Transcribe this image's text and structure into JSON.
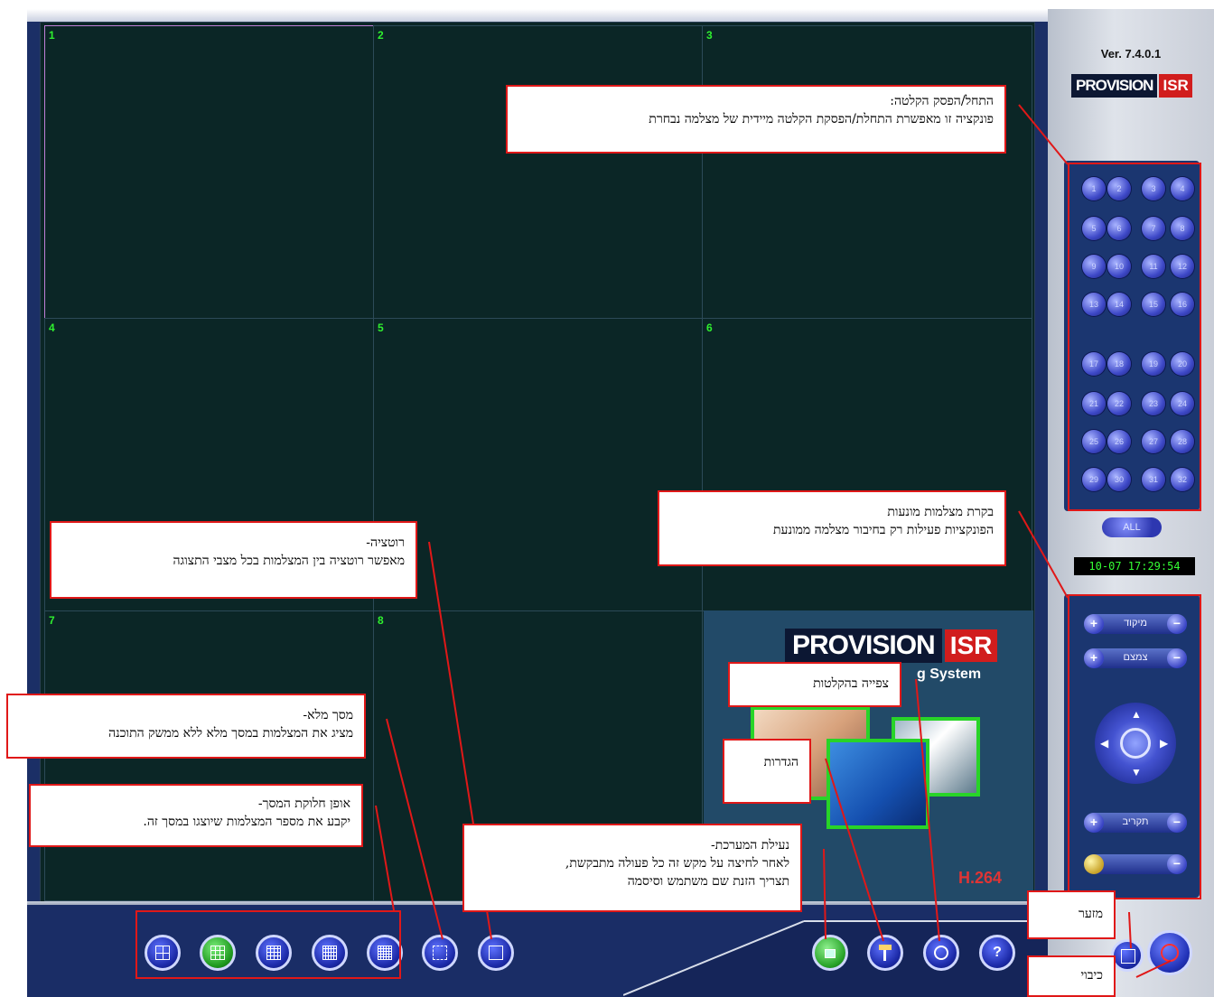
{
  "app": {
    "version": "Ver. 7.4.0.1",
    "brand_main": "PROVISION",
    "brand_suffix": "ISR",
    "splash_partial_text": "g System",
    "codec_label": "H.264",
    "datetime": "10-07 17:29:54",
    "all_button": "ALL"
  },
  "grid": {
    "cells": [
      {
        "num": "1",
        "selected": true
      },
      {
        "num": "2",
        "selected": false
      },
      {
        "num": "3",
        "selected": false
      },
      {
        "num": "4",
        "selected": false
      },
      {
        "num": "5",
        "selected": false
      },
      {
        "num": "6",
        "selected": false
      },
      {
        "num": "7",
        "selected": false
      },
      {
        "num": "8",
        "selected": false
      }
    ]
  },
  "cameras": [
    "1",
    "2",
    "3",
    "4",
    "5",
    "6",
    "7",
    "8",
    "9",
    "10",
    "11",
    "12",
    "13",
    "14",
    "15",
    "16",
    "17",
    "18",
    "19",
    "20",
    "21",
    "22",
    "23",
    "24",
    "25",
    "26",
    "27",
    "28",
    "29",
    "30",
    "31",
    "32"
  ],
  "ptz": {
    "focus_label": "מיקוד",
    "zoom_label": "צמצם",
    "preset_label": "תקריב",
    "plus": "+",
    "minus": "−"
  },
  "layout_buttons": [
    "split-1x1",
    "split-2x2",
    "split-3x3",
    "split-4x4",
    "split-5x5",
    "fullscreen",
    "rotation"
  ],
  "action_buttons": [
    "lock",
    "settings",
    "playback",
    "help",
    "minimize",
    "power"
  ],
  "callouts": {
    "record": {
      "title": "התחל/הפסק הקלטה:",
      "body": "פונקציה זו מאפשרת התחלת/הפסקת הקלטה מיידית של מצלמה נבחרת"
    },
    "ptz": {
      "title": "בקרת מצלמות מונעות",
      "body": "הפונקציות פעילות רק בחיבור מצלמה ממונעת"
    },
    "rotation": {
      "title": "רוטציה-",
      "body": "מאפשר רוטציה בין המצלמות בכל מצבי התצוגה"
    },
    "fullscreen": {
      "title": "מסך מלא-",
      "body": "מציג את המצלמות במסך מלא ללא ממשק התוכנה"
    },
    "split": {
      "title": "אופן חלוקת המסך-",
      "body": "יקבע את מספר המצלמות שיוצגו במסך זה."
    },
    "lock": {
      "title": "נעילת המערכת-",
      "body1": "לאחר לחיצה על מקש זה כל פעולה מתבקשת,",
      "body2": "תצריך הזנת שם משתמש וסיסמה"
    },
    "playback": {
      "title": "צפייה בהקלטות"
    },
    "settings": {
      "title": "הגדרות"
    },
    "minimize": {
      "title": "מזער"
    },
    "exit": {
      "title": "כיבוי"
    }
  }
}
